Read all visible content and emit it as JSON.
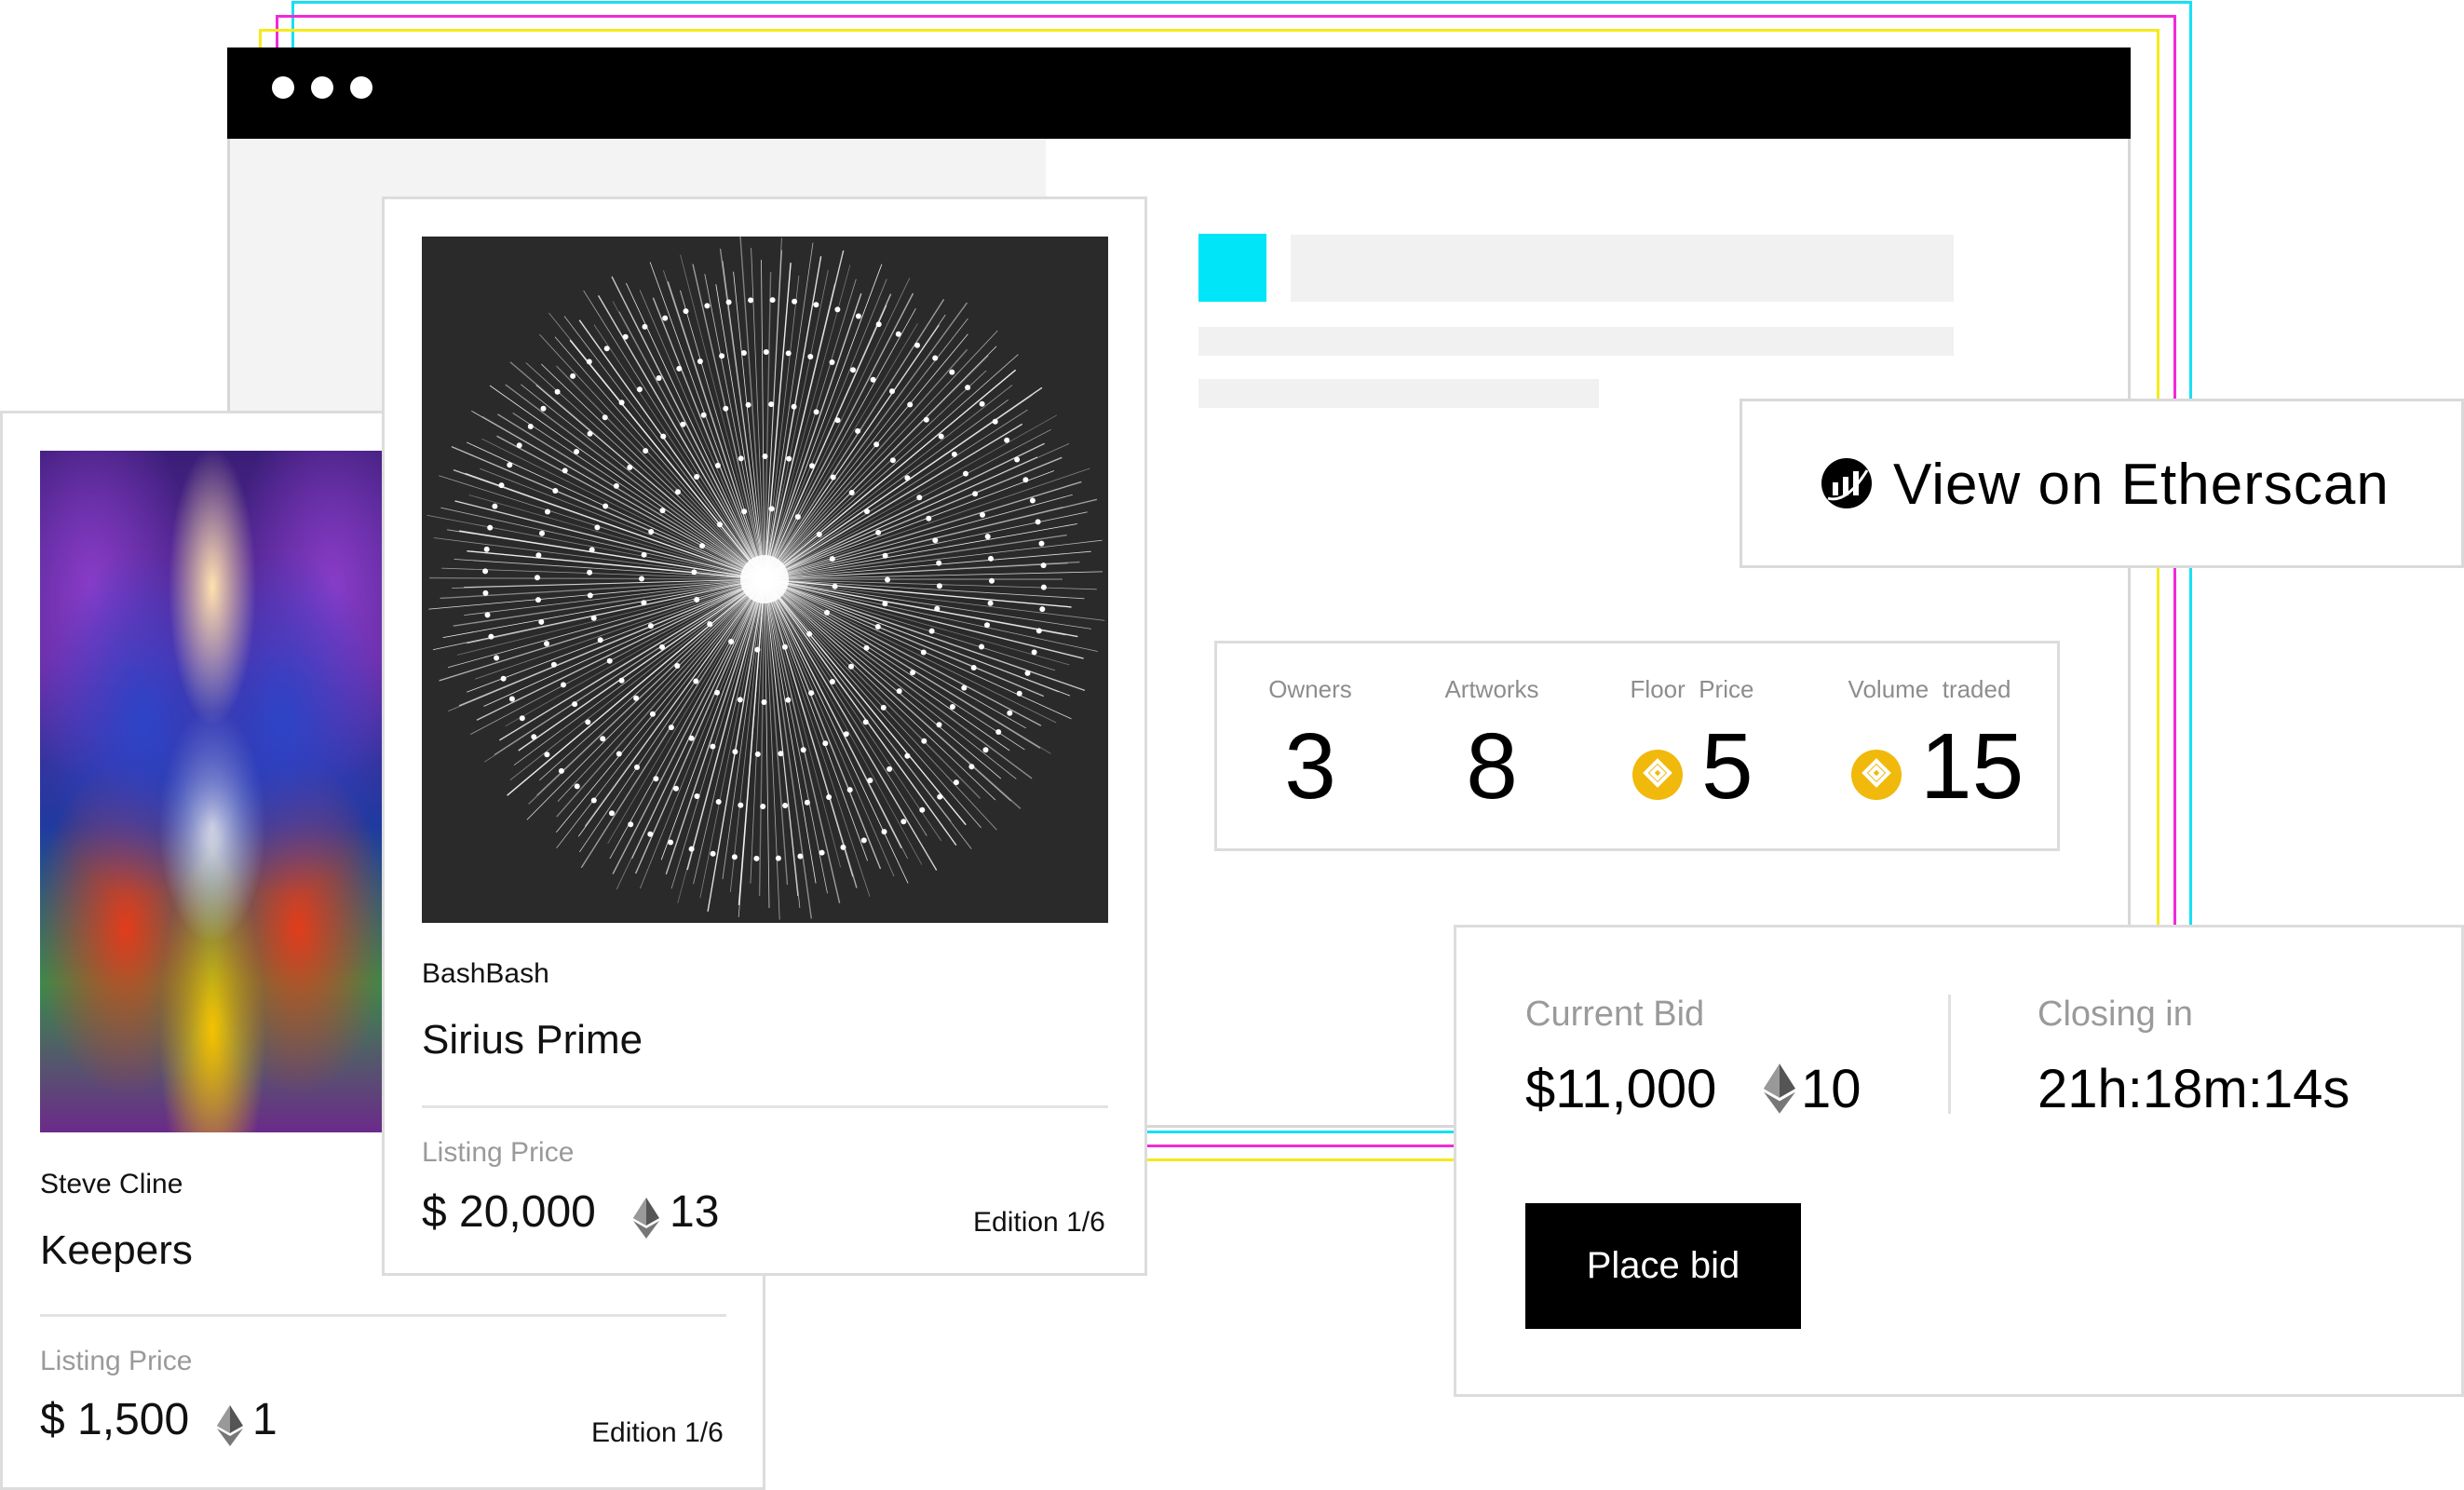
{
  "colors": {
    "neon_cyan": "#16e0f2",
    "neon_magenta": "#ee2bd8",
    "neon_yellow": "#f5ea1a",
    "accent_square": "#00e5f7",
    "bnb_coin": "#f0b90b"
  },
  "browser": {
    "window_controls": [
      "dot",
      "dot",
      "dot"
    ]
  },
  "etherscan": {
    "label": "View on Etherscan",
    "icon": "etherscan-icon"
  },
  "stats": {
    "owners_label": "Owners",
    "owners_value": "3",
    "artworks_label": "Artworks",
    "artworks_value": "8",
    "floor_label": "Floor  Price",
    "floor_value": "5",
    "volume_label": "Volume  traded",
    "volume_value": "15",
    "coin_icon": "bnb-coin-icon"
  },
  "card_keepers": {
    "artist": "Steve Cline",
    "title": "Keepers",
    "listing_label": "Listing Price",
    "price": "$ 1,500",
    "eth": "1",
    "edition": "Edition 1/6"
  },
  "card_sirius": {
    "artist": "BashBash",
    "title": "Sirius Prime",
    "listing_label": "Listing Price",
    "price": "$ 20,000",
    "eth": "13",
    "edition": "Edition 1/6"
  },
  "bid": {
    "current_label": "Current Bid",
    "current_usd": "$11,000",
    "current_eth": "10",
    "closing_label": "Closing in",
    "closing_value": "21h:18m:14s",
    "button": "Place bid"
  }
}
